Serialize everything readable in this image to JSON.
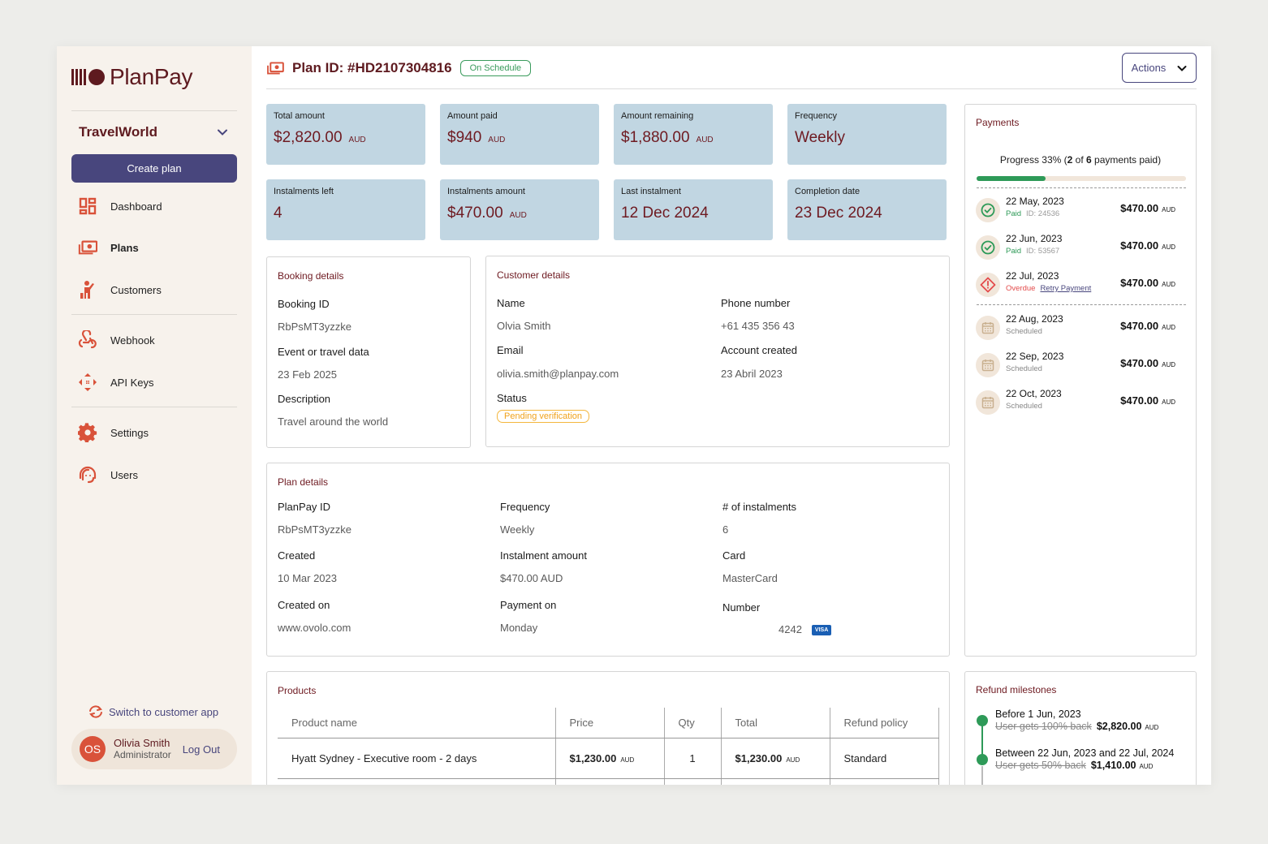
{
  "brand": {
    "name": "PlanPay"
  },
  "sidebar": {
    "org": "TravelWorld",
    "create_plan": "Create plan",
    "items": [
      {
        "label": "Dashboard",
        "icon": "dashboard-icon"
      },
      {
        "label": "Plans",
        "icon": "plans-icon",
        "active": true
      },
      {
        "label": "Customers",
        "icon": "customers-icon"
      },
      {
        "label": "Webhook",
        "icon": "webhook-icon"
      },
      {
        "label": "API Keys",
        "icon": "api-keys-icon"
      },
      {
        "label": "Settings",
        "icon": "gear-icon"
      },
      {
        "label": "Users",
        "icon": "users-icon"
      }
    ],
    "switch_app": "Switch to customer app",
    "user": {
      "initials": "OS",
      "name": "Olivia Smith",
      "role": "Administrator",
      "logout": "Log Out"
    }
  },
  "header": {
    "title": "Plan ID: #HD2107304816",
    "status": "On Schedule",
    "actions": "Actions"
  },
  "stats": [
    {
      "label": "Total amount",
      "value": "$2,820.00",
      "unit": "AUD"
    },
    {
      "label": "Amount paid",
      "value": "$940",
      "unit": "AUD"
    },
    {
      "label": "Amount remaining",
      "value": "$1,880.00",
      "unit": "AUD"
    },
    {
      "label": "Frequency",
      "value": "Weekly",
      "unit": ""
    },
    {
      "label": "Instalments left",
      "value": "4",
      "unit": ""
    },
    {
      "label": "Instalments amount",
      "value": "$470.00",
      "unit": "AUD"
    },
    {
      "label": "Last instalment",
      "value": "12 Dec 2024",
      "unit": ""
    },
    {
      "label": "Completion date",
      "value": "23 Dec 2024",
      "unit": ""
    }
  ],
  "booking": {
    "title": "Booking details",
    "fields": [
      {
        "label": "Booking ID",
        "value": "RbPsMT3yzzke"
      },
      {
        "label": "Event or travel data",
        "value": "23 Feb 2025"
      },
      {
        "label": "Description",
        "value": "Travel around the world"
      }
    ]
  },
  "customer": {
    "title": "Customer details",
    "name_label": "Name",
    "name": "Olvia Smith",
    "phone_label": "Phone number",
    "phone": "+61 435 356 43",
    "email_label": "Email",
    "email": "olivia.smith@planpay.com",
    "created_label": "Account created",
    "created": "23 Abril 2023",
    "status_label": "Status",
    "status": "Pending verification"
  },
  "plan": {
    "title": "Plan details",
    "planpay_id_label": "PlanPay ID",
    "planpay_id": "RbPsMT3yzzke",
    "frequency_label": "Frequency",
    "frequency": "Weekly",
    "instalments_label": "# of instalments",
    "instalments": "6",
    "created_label": "Created",
    "created": "10 Mar 2023",
    "instalment_amount_label": "Instalment amount",
    "instalment_amount": "$470.00 AUD",
    "card_label": "Card",
    "card": "MasterCard",
    "created_on_label": "Created on",
    "created_on": "www.ovolo.com",
    "payment_on_label": "Payment on",
    "payment_on": "Monday",
    "number_label": "Number",
    "number": "4242",
    "card_brand": "VISA"
  },
  "payments": {
    "title": "Payments",
    "progress_prefix": "Progress 33% (",
    "paid_count": "2",
    "of": " of ",
    "total_count": "6",
    "progress_suffix": " payments paid)",
    "progress_fraction": 0.33,
    "items": [
      {
        "date": "22 May, 2023",
        "status": "Paid",
        "id": "ID: 24536",
        "amount": "$470.00",
        "unit": "AUD",
        "state": "paid"
      },
      {
        "date": "22 Jun, 2023",
        "status": "Paid",
        "id": "ID: 53567",
        "amount": "$470.00",
        "unit": "AUD",
        "state": "paid"
      },
      {
        "date": "22 Jul, 2023",
        "status": "Overdue",
        "action": "Retry Payment",
        "amount": "$470.00",
        "unit": "AUD",
        "state": "overdue"
      },
      {
        "date": "22 Aug, 2023",
        "status": "Scheduled",
        "amount": "$470.00",
        "unit": "AUD",
        "state": "scheduled"
      },
      {
        "date": "22 Sep, 2023",
        "status": "Scheduled",
        "amount": "$470.00",
        "unit": "AUD",
        "state": "scheduled"
      },
      {
        "date": "22 Oct, 2023",
        "status": "Scheduled",
        "amount": "$470.00",
        "unit": "AUD",
        "state": "scheduled"
      }
    ]
  },
  "products": {
    "title": "Products",
    "columns": [
      "Product name",
      "Price",
      "Qty",
      "Total",
      "Refund policy"
    ],
    "rows": [
      {
        "name": "Hyatt Sydney - Executive room - 2 days",
        "price": "$1,230.00",
        "price_unit": "AUD",
        "qty": "1",
        "total": "$1,230.00",
        "total_unit": "AUD",
        "policy": "Standard"
      }
    ]
  },
  "refunds": {
    "title": "Refund milestones",
    "items": [
      {
        "title": "Before 1 Jun, 2023",
        "desc": "User gets 100% back",
        "amount": "$2,820.00",
        "unit": "AUD"
      },
      {
        "title": "Between 22 Jun, 2023 and 22 Jul, 2024",
        "desc": "User gets 50% back",
        "amount": "$1,410.00",
        "unit": "AUD"
      }
    ]
  },
  "colors": {
    "brand": "#5e1a1f",
    "accent": "#48467d",
    "icon": "#d9523a",
    "success": "#2e9a58",
    "danger": "#e34b4b",
    "warning": "#f0a21c",
    "stat_bg": "#c1d6e2"
  }
}
